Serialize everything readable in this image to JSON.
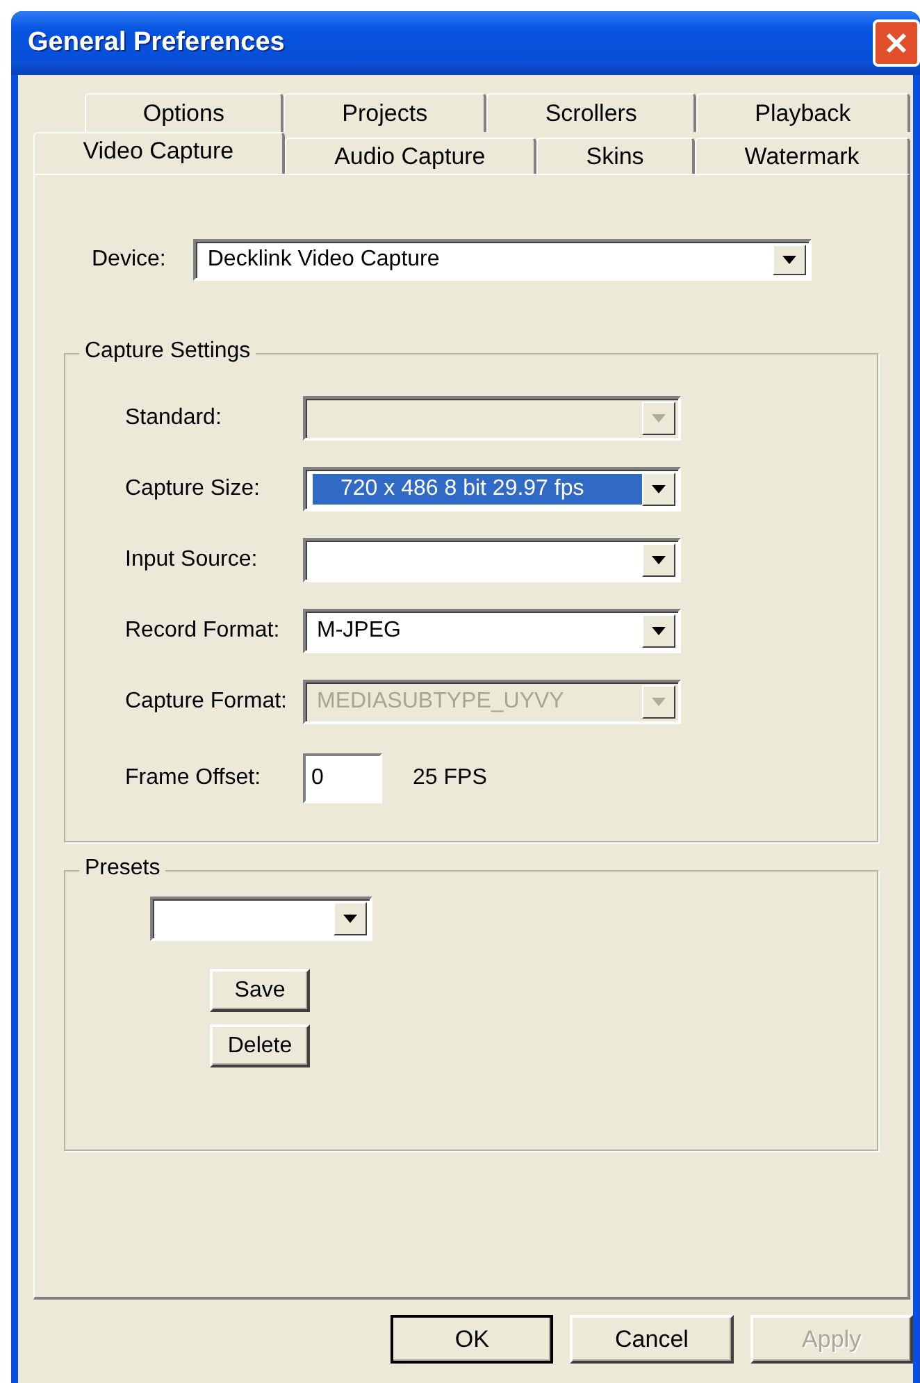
{
  "window": {
    "title": "General Preferences"
  },
  "tab_rows": [
    {
      "tabs": [
        {
          "label": "Options",
          "selected": false
        },
        {
          "label": "Projects",
          "selected": false
        },
        {
          "label": "Scrollers",
          "selected": false
        },
        {
          "label": "Playback",
          "selected": false
        }
      ]
    },
    {
      "tabs": [
        {
          "label": "Video Capture",
          "selected": true
        },
        {
          "label": "Audio Capture",
          "selected": false
        },
        {
          "label": "Skins",
          "selected": false
        },
        {
          "label": "Watermark",
          "selected": false
        }
      ]
    }
  ],
  "device": {
    "label": "Device:",
    "value": "Decklink Video Capture",
    "disabled": false
  },
  "capture_settings": {
    "title": "Capture Settings",
    "fields": [
      {
        "kind": "dropdown",
        "label": "Standard:",
        "disabled": true
      },
      {
        "kind": "dropdown",
        "label": "Capture Size:",
        "value": "720 x 486 8 bit 29.97 fps",
        "highlighted": true,
        "disabled": false
      },
      {
        "kind": "dropdown",
        "label": "Input Source:",
        "disabled": false
      },
      {
        "kind": "dropdown",
        "label": "Record Format:",
        "value": "M-JPEG",
        "highlighted": false,
        "disabled": false
      },
      {
        "kind": "dropdown",
        "label": "Capture Format:",
        "value": "MEDIASUBTYPE_UYVY",
        "highlighted": false,
        "disabled": true
      },
      {
        "kind": "text",
        "label": "Frame Offset:",
        "value": "0",
        "note": "25 FPS"
      }
    ]
  },
  "presets": {
    "title": "Presets",
    "dropdown": {
      "disabled": false
    },
    "buttons": [
      "Save",
      "Delete"
    ]
  },
  "buttons": [
    {
      "label": "OK",
      "default": true,
      "disabled": false
    },
    {
      "label": "Cancel",
      "default": false,
      "disabled": false
    },
    {
      "label": "Apply",
      "default": false,
      "disabled": true
    }
  ]
}
